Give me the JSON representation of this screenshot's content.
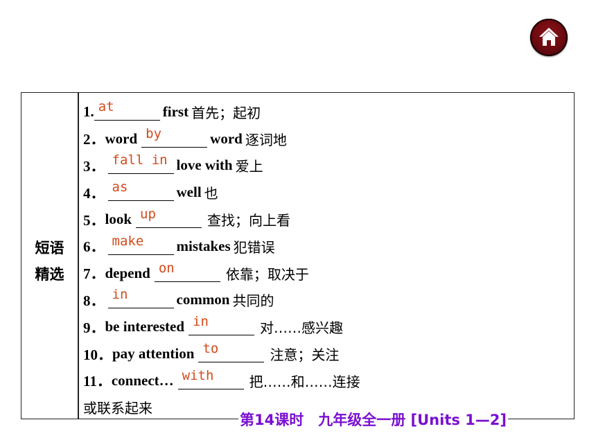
{
  "nav": {
    "home_icon": "home-icon",
    "home_color": "#6a0a10"
  },
  "section": {
    "category_line1": "短语",
    "category_line2": "精选"
  },
  "items": [
    {
      "num": "1.",
      "before": "",
      "answer": "at",
      "after": "first",
      "cn": "首先；起初"
    },
    {
      "num": "2．",
      "before": "word",
      "answer": "by",
      "after": "word",
      "cn": "逐词地"
    },
    {
      "num": "3．",
      "before": "",
      "answer": "fall in",
      "after": "love with",
      "cn": "爱上"
    },
    {
      "num": "4．",
      "before": "",
      "answer": "as",
      "after": "well",
      "cn": "也"
    },
    {
      "num": "5．",
      "before": "look",
      "answer": "up",
      "after": "",
      "cn": "查找；向上看"
    },
    {
      "num": "6．",
      "before": "",
      "answer": "make",
      "after": "mistakes",
      "cn": "犯错误"
    },
    {
      "num": "7．",
      "before": "depend",
      "answer": "on",
      "after": "",
      "cn": "依靠；取决于"
    },
    {
      "num": "8．",
      "before": "",
      "answer": "in",
      "after": "common",
      "cn": "共同的"
    },
    {
      "num": "9．",
      "before": "be interested",
      "answer": "in",
      "after": "",
      "cn": "对……感兴趣"
    },
    {
      "num": "10．",
      "before": "pay attention",
      "answer": "to",
      "after": "",
      "cn": "注意；关注"
    },
    {
      "num": "11．",
      "before": "connect…",
      "answer": "with",
      "after": "",
      "cn": "把……和……连接"
    }
  ],
  "continuation": "或联系起来",
  "footer": {
    "title": "第14课时　九年级全一册 [Units 1—2]",
    "color": "#7a10d0"
  },
  "answer_color": "#d34a1c"
}
